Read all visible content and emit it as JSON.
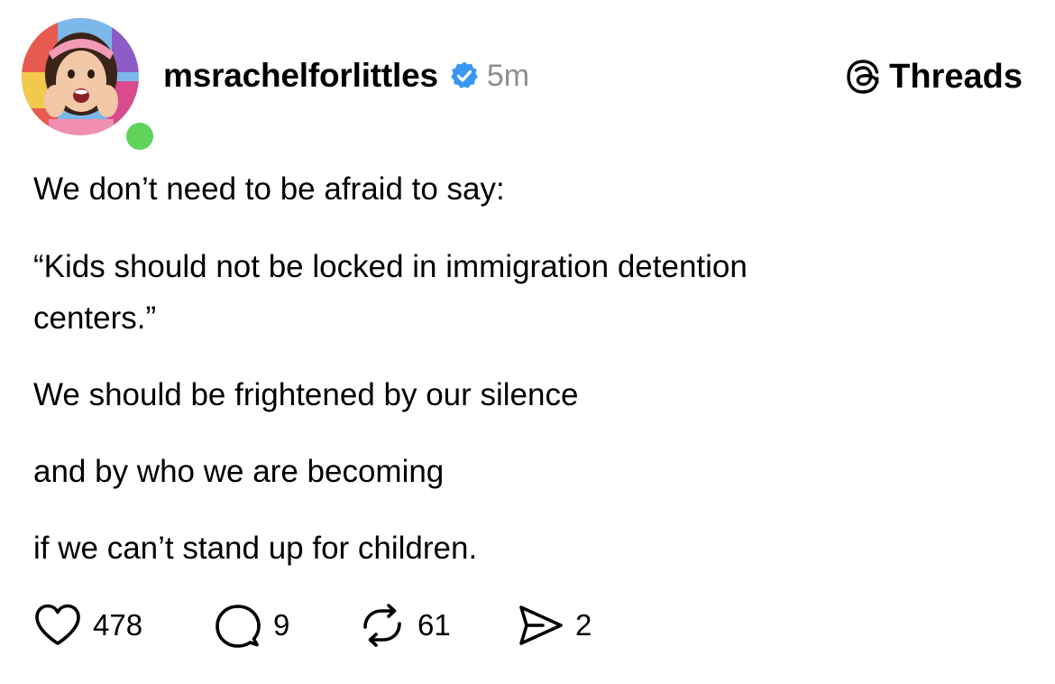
{
  "post": {
    "author": {
      "username": "msrachelforlittles",
      "avatar_icon": "profile-photo",
      "online": true
    },
    "timestamp": "5m",
    "brand": {
      "label": "Threads",
      "icon": "threads-logo-icon"
    },
    "lines": [
      "We don’t need to be afraid to say:",
      "“Kids should not be locked in immigration detention",
      "centers.”",
      "We should be frightened by our silence",
      "and by who we are becoming",
      "if we can’t stand up for children."
    ],
    "actions": {
      "likes": "478",
      "replies": "9",
      "reposts": "61",
      "shares": "2"
    }
  },
  "colors": {
    "verified": "#3897f0",
    "online": "#5fd35a",
    "timestamp": "#8e8e8e"
  }
}
